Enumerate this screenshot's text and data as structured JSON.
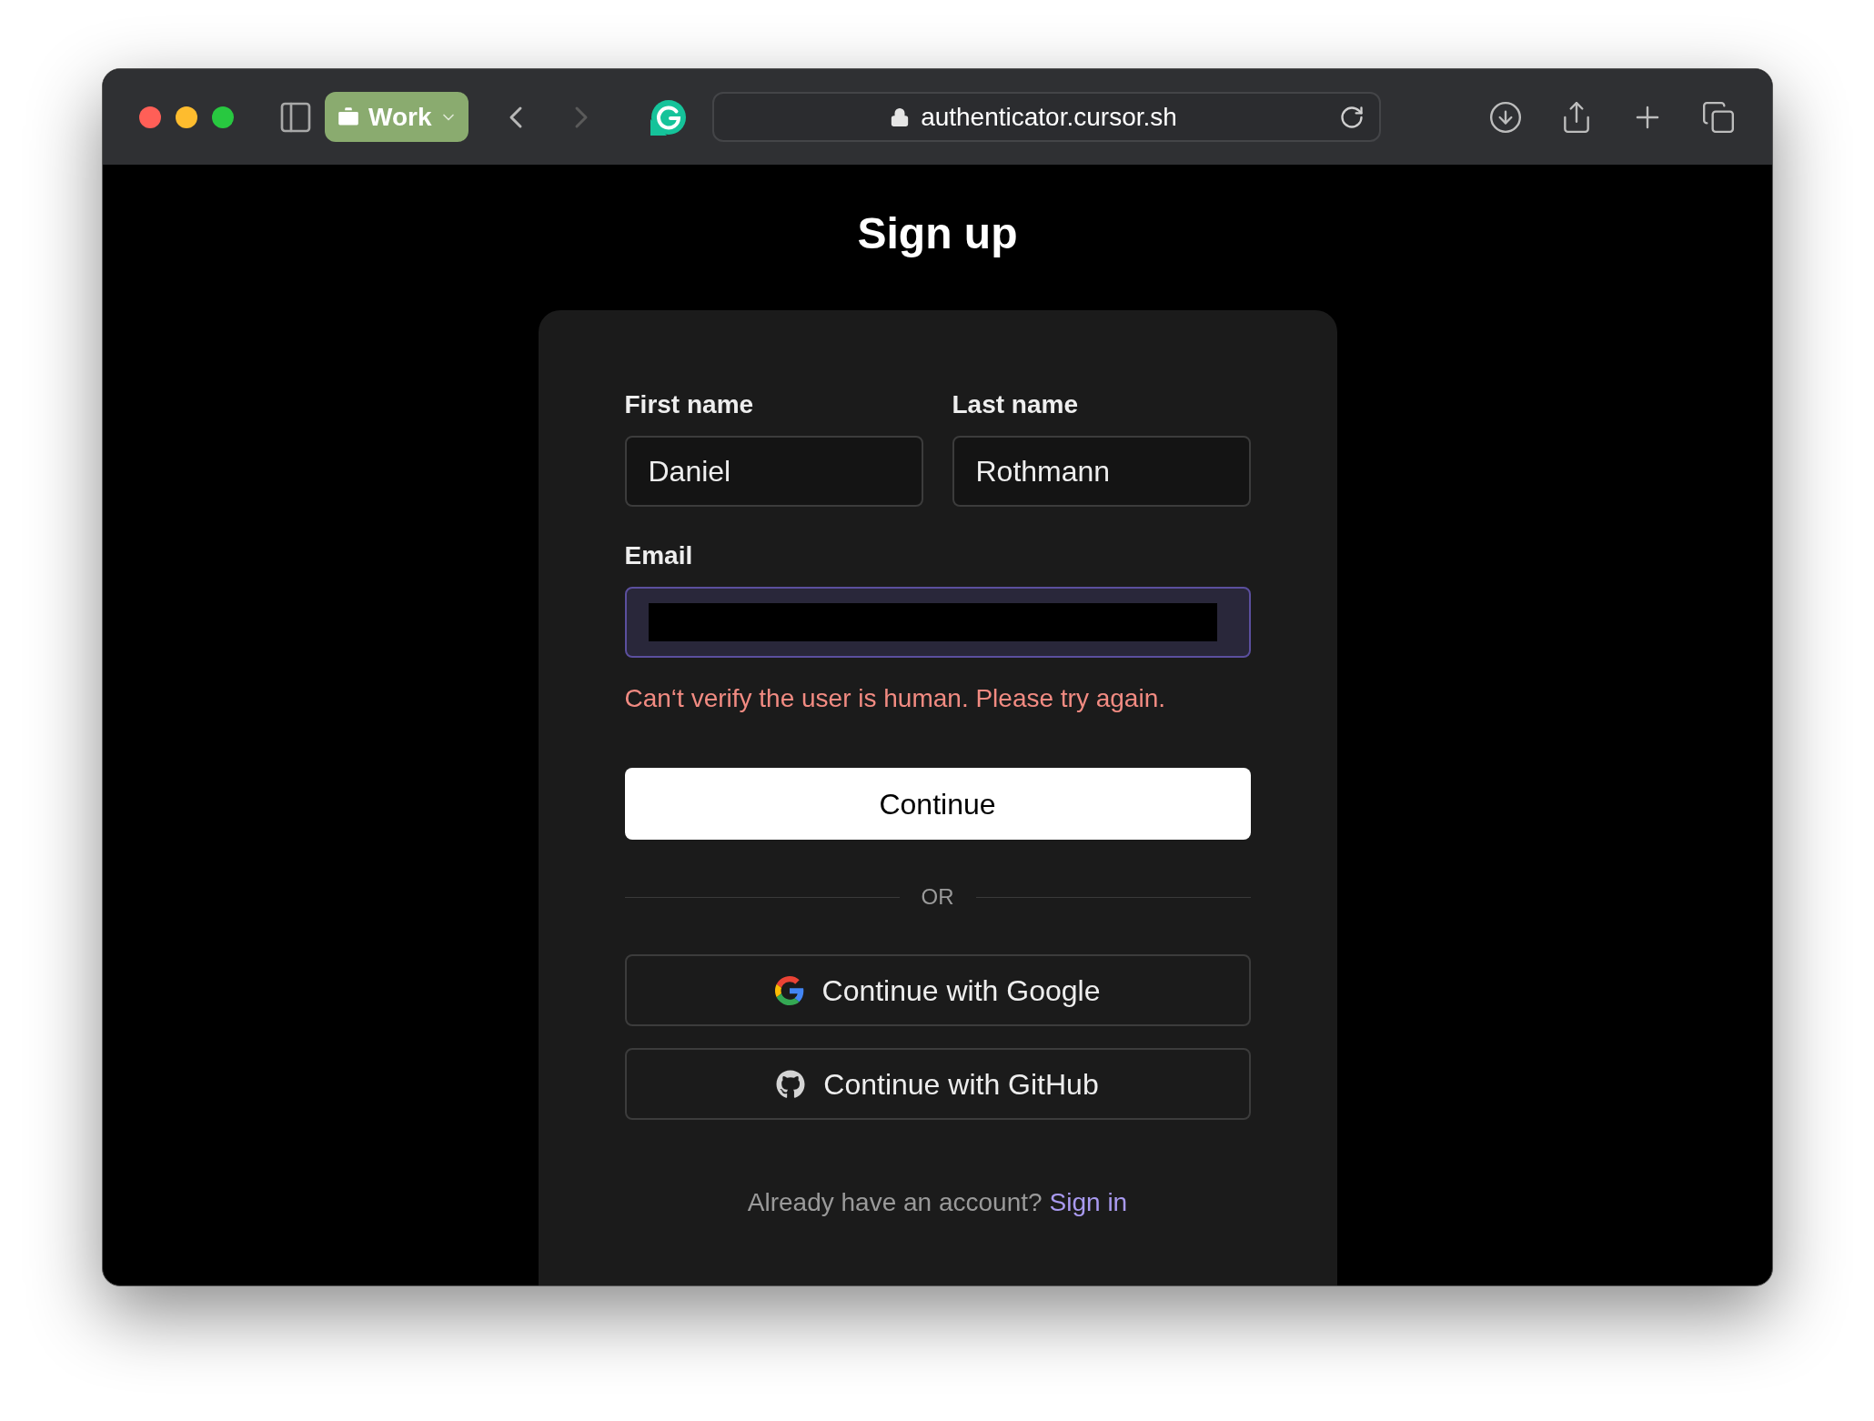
{
  "browser": {
    "profile": {
      "label": "Work"
    },
    "back": {
      "disabled": false
    },
    "forward": {
      "disabled": true
    },
    "url": "authenticator.cursor.sh"
  },
  "page": {
    "title": "Sign up",
    "name_fields": [
      {
        "label": "First name",
        "value": "Daniel",
        "focused": false
      },
      {
        "label": "Last name",
        "value": "Rothmann",
        "focused": false
      }
    ],
    "email": {
      "label": "Email",
      "focused": true,
      "redacted": true
    },
    "error": "Can‘t verify the user is human. Please try again.",
    "submit": "Continue",
    "divider": "OR",
    "oauth": [
      {
        "kind": "google",
        "label": "Continue with Google"
      },
      {
        "kind": "github",
        "label": "Continue with GitHub"
      }
    ],
    "footer": {
      "text": "Already have an account?",
      "link": "Sign in"
    }
  }
}
